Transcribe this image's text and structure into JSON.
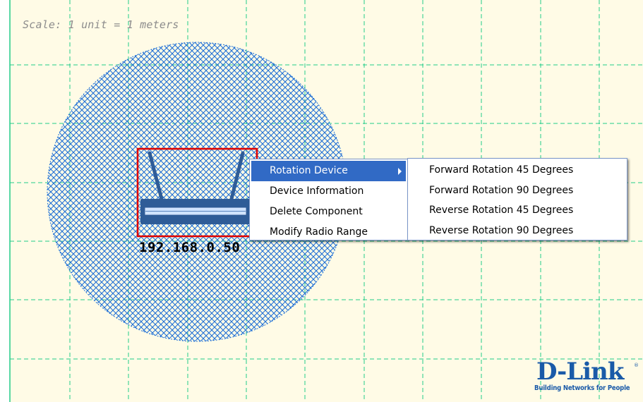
{
  "canvas": {
    "background_color": "#fffbe6",
    "grid_color": "#22cc88",
    "coverage_color": "#1f6fd6",
    "selection_color": "#e00000",
    "scale_label": "Scale: 1 unit = 1 meters"
  },
  "device": {
    "icon": "wireless-router-icon",
    "ip_label": "192.168.0.50"
  },
  "context_menu": {
    "items": [
      {
        "label": "Rotation Device",
        "highlighted": true,
        "has_submenu": true
      },
      {
        "label": "Device Information"
      },
      {
        "label": "Delete Component"
      },
      {
        "label": "Modify Radio Range"
      }
    ],
    "highlight_color": "#316ac5"
  },
  "rotation_submenu": {
    "items": [
      {
        "label": "Forward Rotation 45 Degrees"
      },
      {
        "label": "Forward Rotation 90 Degrees"
      },
      {
        "label": "Reverse Rotation 45 Degrees"
      },
      {
        "label": "Reverse Rotation 90 Degrees"
      }
    ]
  },
  "logo": {
    "brand": "D-Link",
    "tagline": "Building Networks for People",
    "trademark": "®",
    "color": "#1a5aa8"
  }
}
